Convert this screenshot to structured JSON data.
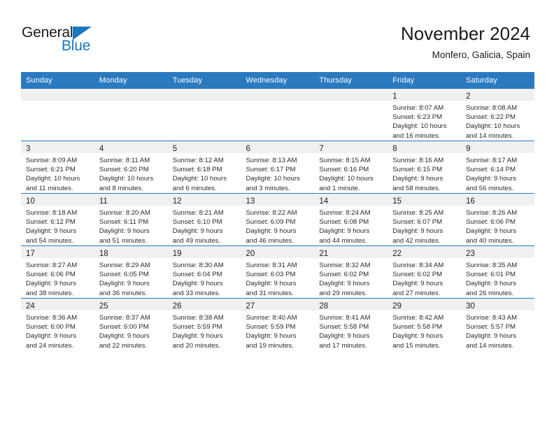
{
  "brand": {
    "name_line1": "General",
    "name_line2": "Blue",
    "triangle_color": "#1878c0"
  },
  "header": {
    "title": "November 2024",
    "subtitle": "Monfero, Galicia, Spain"
  },
  "colors": {
    "header_blue": "#2a7ac0",
    "daynum_band": "#f0f0f0",
    "text": "#222222"
  },
  "calendar": {
    "weekday_headers": [
      "Sunday",
      "Monday",
      "Tuesday",
      "Wednesday",
      "Thursday",
      "Friday",
      "Saturday"
    ],
    "weeks": [
      [
        {
          "empty": true
        },
        {
          "empty": true
        },
        {
          "empty": true
        },
        {
          "empty": true
        },
        {
          "empty": true
        },
        {
          "day": "1",
          "sunrise": "Sunrise: 8:07 AM",
          "sunset": "Sunset: 6:23 PM",
          "daylight1": "Daylight: 10 hours",
          "daylight2": "and 16 minutes."
        },
        {
          "day": "2",
          "sunrise": "Sunrise: 8:08 AM",
          "sunset": "Sunset: 6:22 PM",
          "daylight1": "Daylight: 10 hours",
          "daylight2": "and 14 minutes."
        }
      ],
      [
        {
          "day": "3",
          "sunrise": "Sunrise: 8:09 AM",
          "sunset": "Sunset: 6:21 PM",
          "daylight1": "Daylight: 10 hours",
          "daylight2": "and 11 minutes."
        },
        {
          "day": "4",
          "sunrise": "Sunrise: 8:11 AM",
          "sunset": "Sunset: 6:20 PM",
          "daylight1": "Daylight: 10 hours",
          "daylight2": "and 8 minutes."
        },
        {
          "day": "5",
          "sunrise": "Sunrise: 8:12 AM",
          "sunset": "Sunset: 6:18 PM",
          "daylight1": "Daylight: 10 hours",
          "daylight2": "and 6 minutes."
        },
        {
          "day": "6",
          "sunrise": "Sunrise: 8:13 AM",
          "sunset": "Sunset: 6:17 PM",
          "daylight1": "Daylight: 10 hours",
          "daylight2": "and 3 minutes."
        },
        {
          "day": "7",
          "sunrise": "Sunrise: 8:15 AM",
          "sunset": "Sunset: 6:16 PM",
          "daylight1": "Daylight: 10 hours",
          "daylight2": "and 1 minute."
        },
        {
          "day": "8",
          "sunrise": "Sunrise: 8:16 AM",
          "sunset": "Sunset: 6:15 PM",
          "daylight1": "Daylight: 9 hours",
          "daylight2": "and 58 minutes."
        },
        {
          "day": "9",
          "sunrise": "Sunrise: 8:17 AM",
          "sunset": "Sunset: 6:14 PM",
          "daylight1": "Daylight: 9 hours",
          "daylight2": "and 56 minutes."
        }
      ],
      [
        {
          "day": "10",
          "sunrise": "Sunrise: 8:18 AM",
          "sunset": "Sunset: 6:12 PM",
          "daylight1": "Daylight: 9 hours",
          "daylight2": "and 54 minutes."
        },
        {
          "day": "11",
          "sunrise": "Sunrise: 8:20 AM",
          "sunset": "Sunset: 6:11 PM",
          "daylight1": "Daylight: 9 hours",
          "daylight2": "and 51 minutes."
        },
        {
          "day": "12",
          "sunrise": "Sunrise: 8:21 AM",
          "sunset": "Sunset: 6:10 PM",
          "daylight1": "Daylight: 9 hours",
          "daylight2": "and 49 minutes."
        },
        {
          "day": "13",
          "sunrise": "Sunrise: 8:22 AM",
          "sunset": "Sunset: 6:09 PM",
          "daylight1": "Daylight: 9 hours",
          "daylight2": "and 46 minutes."
        },
        {
          "day": "14",
          "sunrise": "Sunrise: 8:24 AM",
          "sunset": "Sunset: 6:08 PM",
          "daylight1": "Daylight: 9 hours",
          "daylight2": "and 44 minutes."
        },
        {
          "day": "15",
          "sunrise": "Sunrise: 8:25 AM",
          "sunset": "Sunset: 6:07 PM",
          "daylight1": "Daylight: 9 hours",
          "daylight2": "and 42 minutes."
        },
        {
          "day": "16",
          "sunrise": "Sunrise: 8:26 AM",
          "sunset": "Sunset: 6:06 PM",
          "daylight1": "Daylight: 9 hours",
          "daylight2": "and 40 minutes."
        }
      ],
      [
        {
          "day": "17",
          "sunrise": "Sunrise: 8:27 AM",
          "sunset": "Sunset: 6:06 PM",
          "daylight1": "Daylight: 9 hours",
          "daylight2": "and 38 minutes."
        },
        {
          "day": "18",
          "sunrise": "Sunrise: 8:29 AM",
          "sunset": "Sunset: 6:05 PM",
          "daylight1": "Daylight: 9 hours",
          "daylight2": "and 36 minutes."
        },
        {
          "day": "19",
          "sunrise": "Sunrise: 8:30 AM",
          "sunset": "Sunset: 6:04 PM",
          "daylight1": "Daylight: 9 hours",
          "daylight2": "and 33 minutes."
        },
        {
          "day": "20",
          "sunrise": "Sunrise: 8:31 AM",
          "sunset": "Sunset: 6:03 PM",
          "daylight1": "Daylight: 9 hours",
          "daylight2": "and 31 minutes."
        },
        {
          "day": "21",
          "sunrise": "Sunrise: 8:32 AM",
          "sunset": "Sunset: 6:02 PM",
          "daylight1": "Daylight: 9 hours",
          "daylight2": "and 29 minutes."
        },
        {
          "day": "22",
          "sunrise": "Sunrise: 8:34 AM",
          "sunset": "Sunset: 6:02 PM",
          "daylight1": "Daylight: 9 hours",
          "daylight2": "and 27 minutes."
        },
        {
          "day": "23",
          "sunrise": "Sunrise: 8:35 AM",
          "sunset": "Sunset: 6:01 PM",
          "daylight1": "Daylight: 9 hours",
          "daylight2": "and 26 minutes."
        }
      ],
      [
        {
          "day": "24",
          "sunrise": "Sunrise: 8:36 AM",
          "sunset": "Sunset: 6:00 PM",
          "daylight1": "Daylight: 9 hours",
          "daylight2": "and 24 minutes."
        },
        {
          "day": "25",
          "sunrise": "Sunrise: 8:37 AM",
          "sunset": "Sunset: 6:00 PM",
          "daylight1": "Daylight: 9 hours",
          "daylight2": "and 22 minutes."
        },
        {
          "day": "26",
          "sunrise": "Sunrise: 8:38 AM",
          "sunset": "Sunset: 5:59 PM",
          "daylight1": "Daylight: 9 hours",
          "daylight2": "and 20 minutes."
        },
        {
          "day": "27",
          "sunrise": "Sunrise: 8:40 AM",
          "sunset": "Sunset: 5:59 PM",
          "daylight1": "Daylight: 9 hours",
          "daylight2": "and 19 minutes."
        },
        {
          "day": "28",
          "sunrise": "Sunrise: 8:41 AM",
          "sunset": "Sunset: 5:58 PM",
          "daylight1": "Daylight: 9 hours",
          "daylight2": "and 17 minutes."
        },
        {
          "day": "29",
          "sunrise": "Sunrise: 8:42 AM",
          "sunset": "Sunset: 5:58 PM",
          "daylight1": "Daylight: 9 hours",
          "daylight2": "and 15 minutes."
        },
        {
          "day": "30",
          "sunrise": "Sunrise: 8:43 AM",
          "sunset": "Sunset: 5:57 PM",
          "daylight1": "Daylight: 9 hours",
          "daylight2": "and 14 minutes."
        }
      ]
    ]
  }
}
